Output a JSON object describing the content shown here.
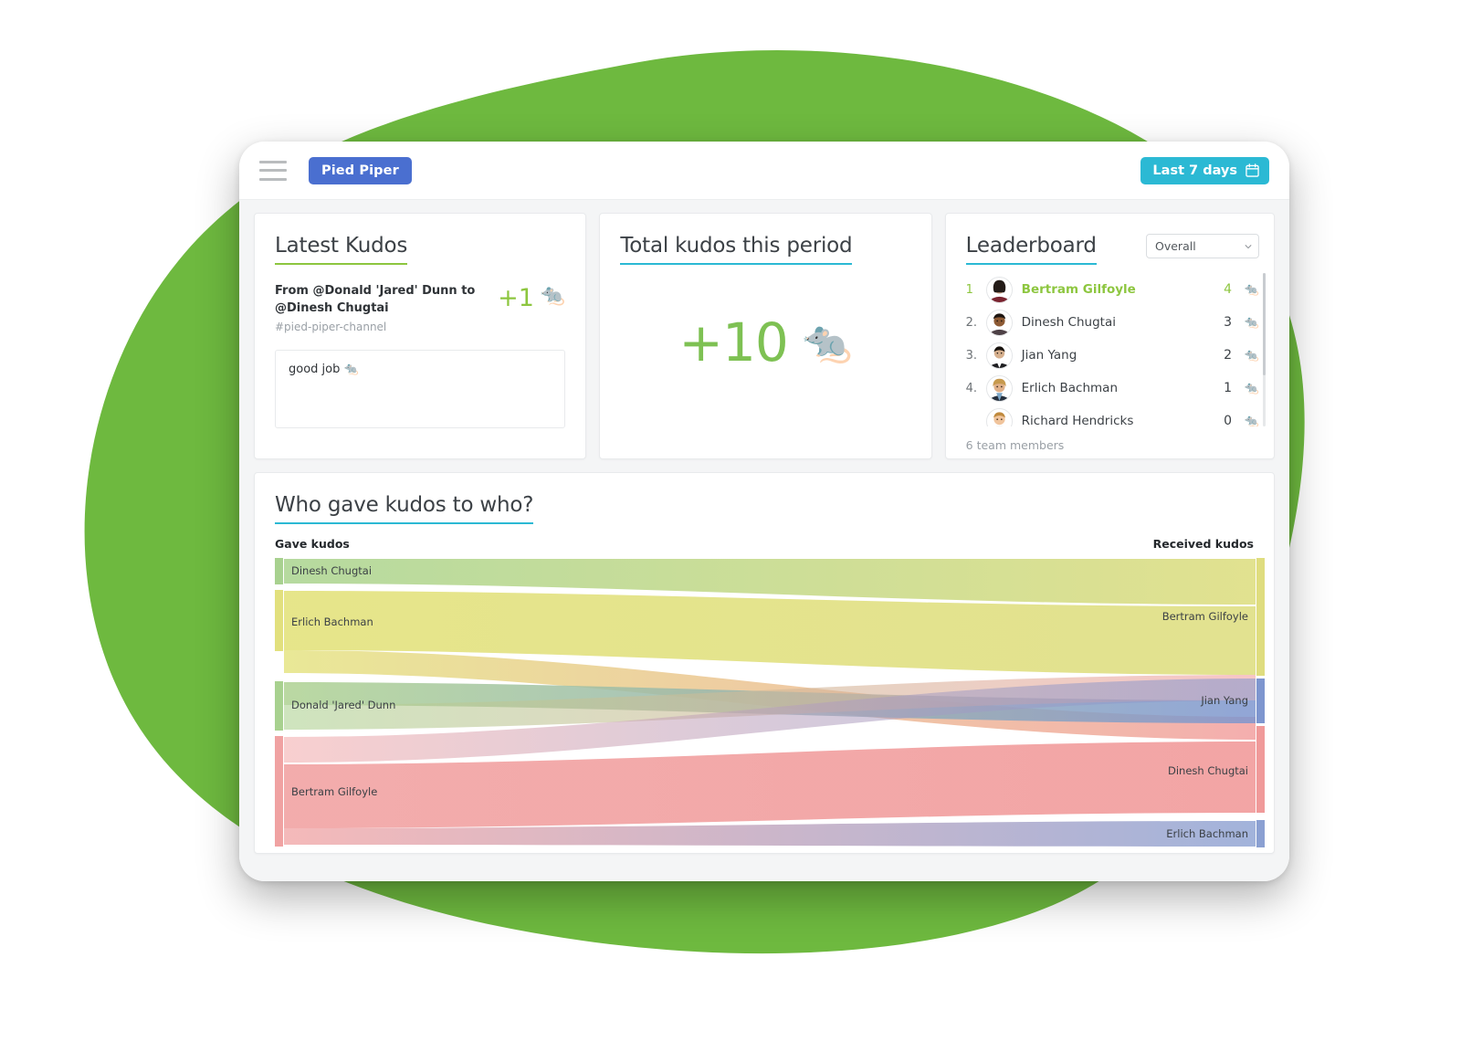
{
  "navbar": {
    "menu_icon": "hamburger-menu-icon",
    "brand": "Pied Piper",
    "date_range": "Last 7 days",
    "calendar_icon": "calendar-icon"
  },
  "latest_kudos": {
    "title": "Latest Kudos",
    "from_to": "From @Donald 'Jared' Dunn to @Dinesh Chugtai",
    "channel": "#pied-piper-channel",
    "amount": "+1",
    "emoji": "🐀",
    "message": "good job 🐀"
  },
  "total_kudos": {
    "title": "Total kudos this period",
    "value": "+10",
    "emoji": "🐀"
  },
  "leaderboard": {
    "title": "Leaderboard",
    "filter_selected": "Overall",
    "filter_options": [
      "Overall"
    ],
    "footer": "6 team members",
    "emoji": "🐀",
    "rows": [
      {
        "rank": "1",
        "name": "Bertram Gilfoyle",
        "count": "4",
        "highlight": true
      },
      {
        "rank": "2.",
        "name": "Dinesh Chugtai",
        "count": "3",
        "highlight": false
      },
      {
        "rank": "3.",
        "name": "Jian Yang",
        "count": "2",
        "highlight": false
      },
      {
        "rank": "4.",
        "name": "Erlich Bachman",
        "count": "1",
        "highlight": false
      },
      {
        "rank": "",
        "name": "Richard Hendricks",
        "count": "0",
        "highlight": false
      }
    ]
  },
  "sankey": {
    "title": "Who gave kudos to who?",
    "left_axis": "Gave kudos",
    "right_axis": "Received kudos"
  },
  "chart_data": {
    "type": "sankey",
    "title": "Who gave kudos to who?",
    "xlabel": "Gave kudos",
    "ylabel": "Received kudos",
    "source_nodes": [
      {
        "name": "Dinesh Chugtai",
        "value": 2,
        "color": "#b2d89a"
      },
      {
        "name": "Erlich Bachman",
        "value": 4,
        "color": "#e5e484"
      },
      {
        "name": "Donald 'Jared' Dunn",
        "value": 2,
        "color": "#aed292"
      },
      {
        "name": "Bertram Gilfoyle",
        "value": 5,
        "color": "#f2a8a8"
      }
    ],
    "target_nodes": [
      {
        "name": "Bertram Gilfoyle",
        "value": 5,
        "color": "#e0e08a"
      },
      {
        "name": "Jian Yang",
        "value": 3,
        "color": "#7e96cf"
      },
      {
        "name": "Dinesh Chugtai",
        "value": 4,
        "color": "#f2a0a0"
      },
      {
        "name": "Erlich Bachman",
        "value": 1,
        "color": "#8ba0d2"
      }
    ],
    "links": [
      {
        "source": "Dinesh Chugtai",
        "target": "Bertram Gilfoyle",
        "value": 2
      },
      {
        "source": "Erlich Bachman",
        "target": "Bertram Gilfoyle",
        "value": 3
      },
      {
        "source": "Erlich Bachman",
        "target": "Dinesh Chugtai",
        "value": 1
      },
      {
        "source": "Donald 'Jared' Dunn",
        "target": "Jian Yang",
        "value": 1
      },
      {
        "source": "Donald 'Jared' Dunn",
        "target": "Dinesh Chugtai",
        "value": 1
      },
      {
        "source": "Bertram Gilfoyle",
        "target": "Jian Yang",
        "value": 2
      },
      {
        "source": "Bertram Gilfoyle",
        "target": "Dinesh Chugtai",
        "value": 2
      },
      {
        "source": "Bertram Gilfoyle",
        "target": "Erlich Bachman",
        "value": 1
      }
    ],
    "legend": [],
    "grid": false
  },
  "colors": {
    "brand_blue": "#4a6fd0",
    "accent_cyan": "#2bb9d4",
    "accent_green": "#8dc63f",
    "blob_green": "#6eb93f",
    "page_bg": "#f4f5f6"
  }
}
